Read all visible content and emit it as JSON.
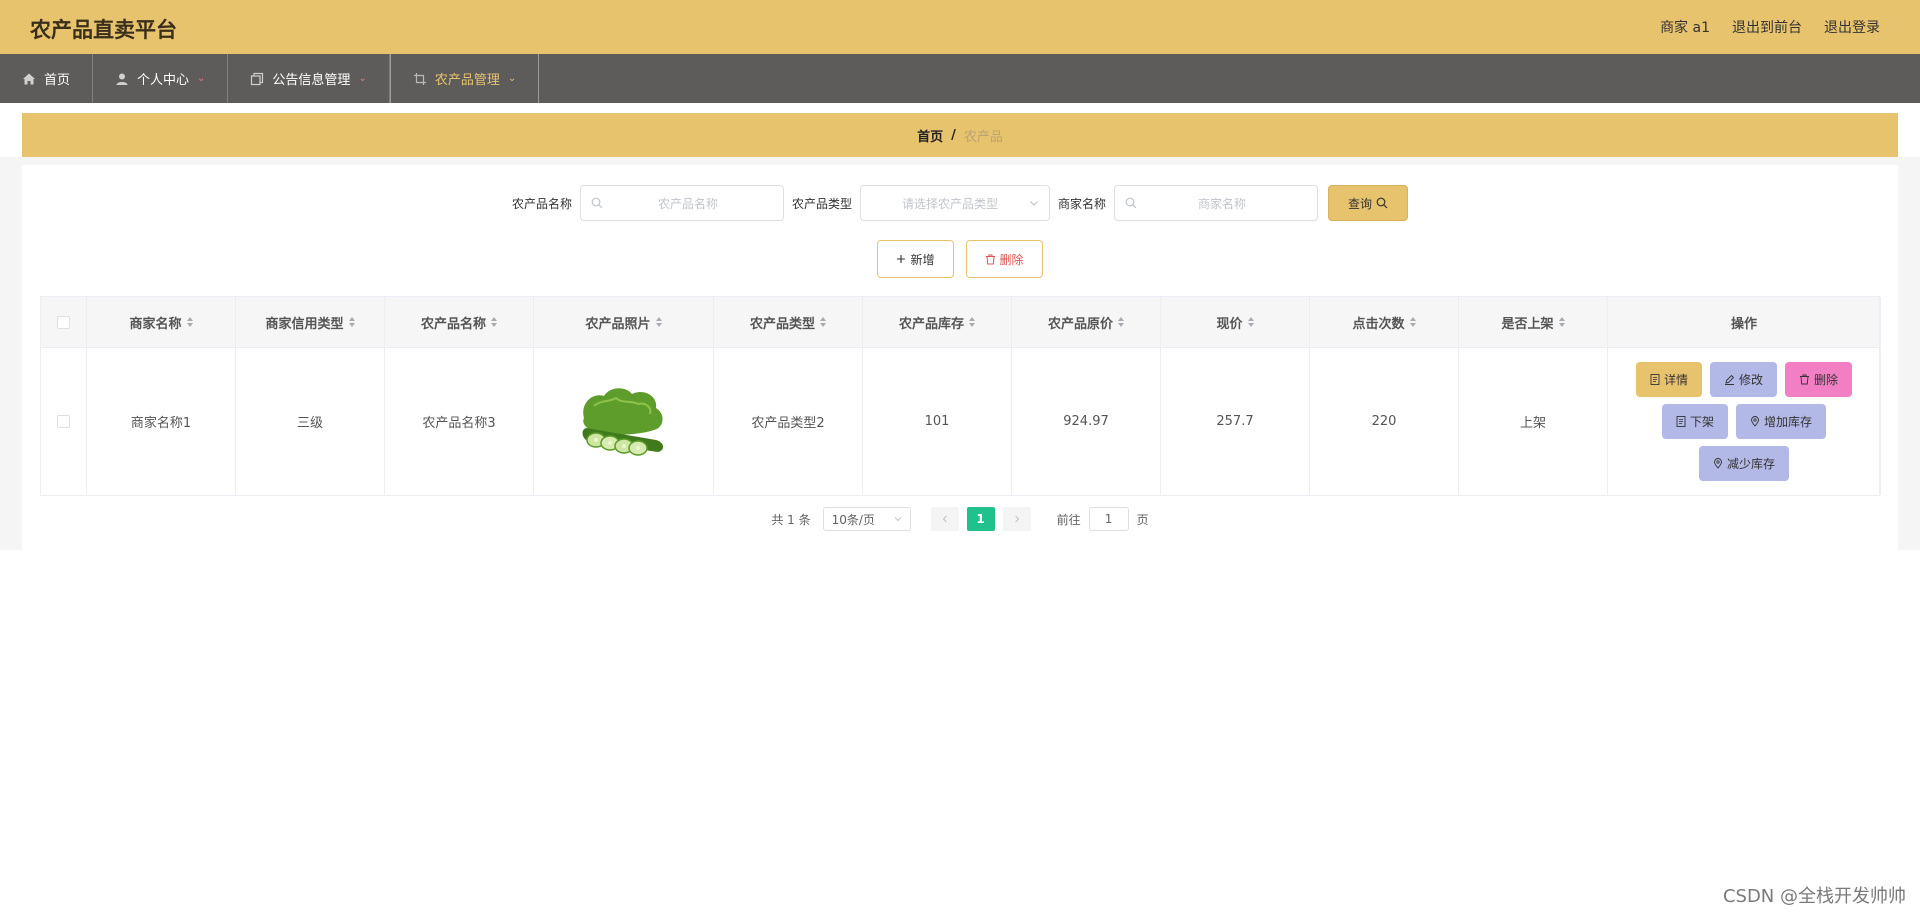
{
  "header": {
    "title": "农产品直卖平台",
    "user": "商家 a1",
    "front_link": "退出到前台",
    "logout_link": "退出登录"
  },
  "nav": {
    "items": [
      {
        "label": "首页",
        "icon": "home-icon"
      },
      {
        "label": "个人中心",
        "icon": "user-icon"
      },
      {
        "label": "公告信息管理",
        "icon": "copy-icon"
      },
      {
        "label": "农产品管理",
        "icon": "crop-icon"
      }
    ],
    "active": "农产品管理"
  },
  "breadcrumb": {
    "home": "首页",
    "separator": "/",
    "current": "农产品"
  },
  "search": {
    "name_label": "农产品名称",
    "name_placeholder": "农产品名称",
    "type_label": "农产品类型",
    "type_placeholder": "请选择农产品类型",
    "merchant_label": "商家名称",
    "merchant_placeholder": "商家名称",
    "query_button": "查询"
  },
  "actions": {
    "add_button": "新增",
    "delete_button": "删除"
  },
  "table": {
    "columns": [
      "商家名称",
      "商家信用类型",
      "农产品名称",
      "农产品照片",
      "农产品类型",
      "农产品库存",
      "农产品原价",
      "现价",
      "点击次数",
      "是否上架",
      "操作"
    ],
    "rows": [
      {
        "merchant": "商家名称1",
        "credit": "三级",
        "name": "农产品名称3",
        "photo": "cucumber-image",
        "type": "农产品类型2",
        "stock": "101",
        "original_price": "924.97",
        "price": "257.7",
        "clicks": "220",
        "listed": "上架"
      }
    ],
    "row_actions": {
      "detail": "详情",
      "edit": "修改",
      "delete": "删除",
      "unlist": "下架",
      "add_stock": "增加库存",
      "reduce_stock": "减少库存"
    }
  },
  "pagination": {
    "total": "共 1 条",
    "page_size": "10条/页",
    "current_page": "1",
    "goto_label": "前往",
    "goto_value": "1",
    "page_suffix": "页"
  },
  "watermark": "CSDN @全栈开发帅帅",
  "colors": {
    "topbar": "#e8c36e",
    "navbar": "#5e5c5b",
    "active_page": "#20c18c",
    "delete_button": "#f27fc4",
    "purple_button": "#b3b9e6"
  }
}
